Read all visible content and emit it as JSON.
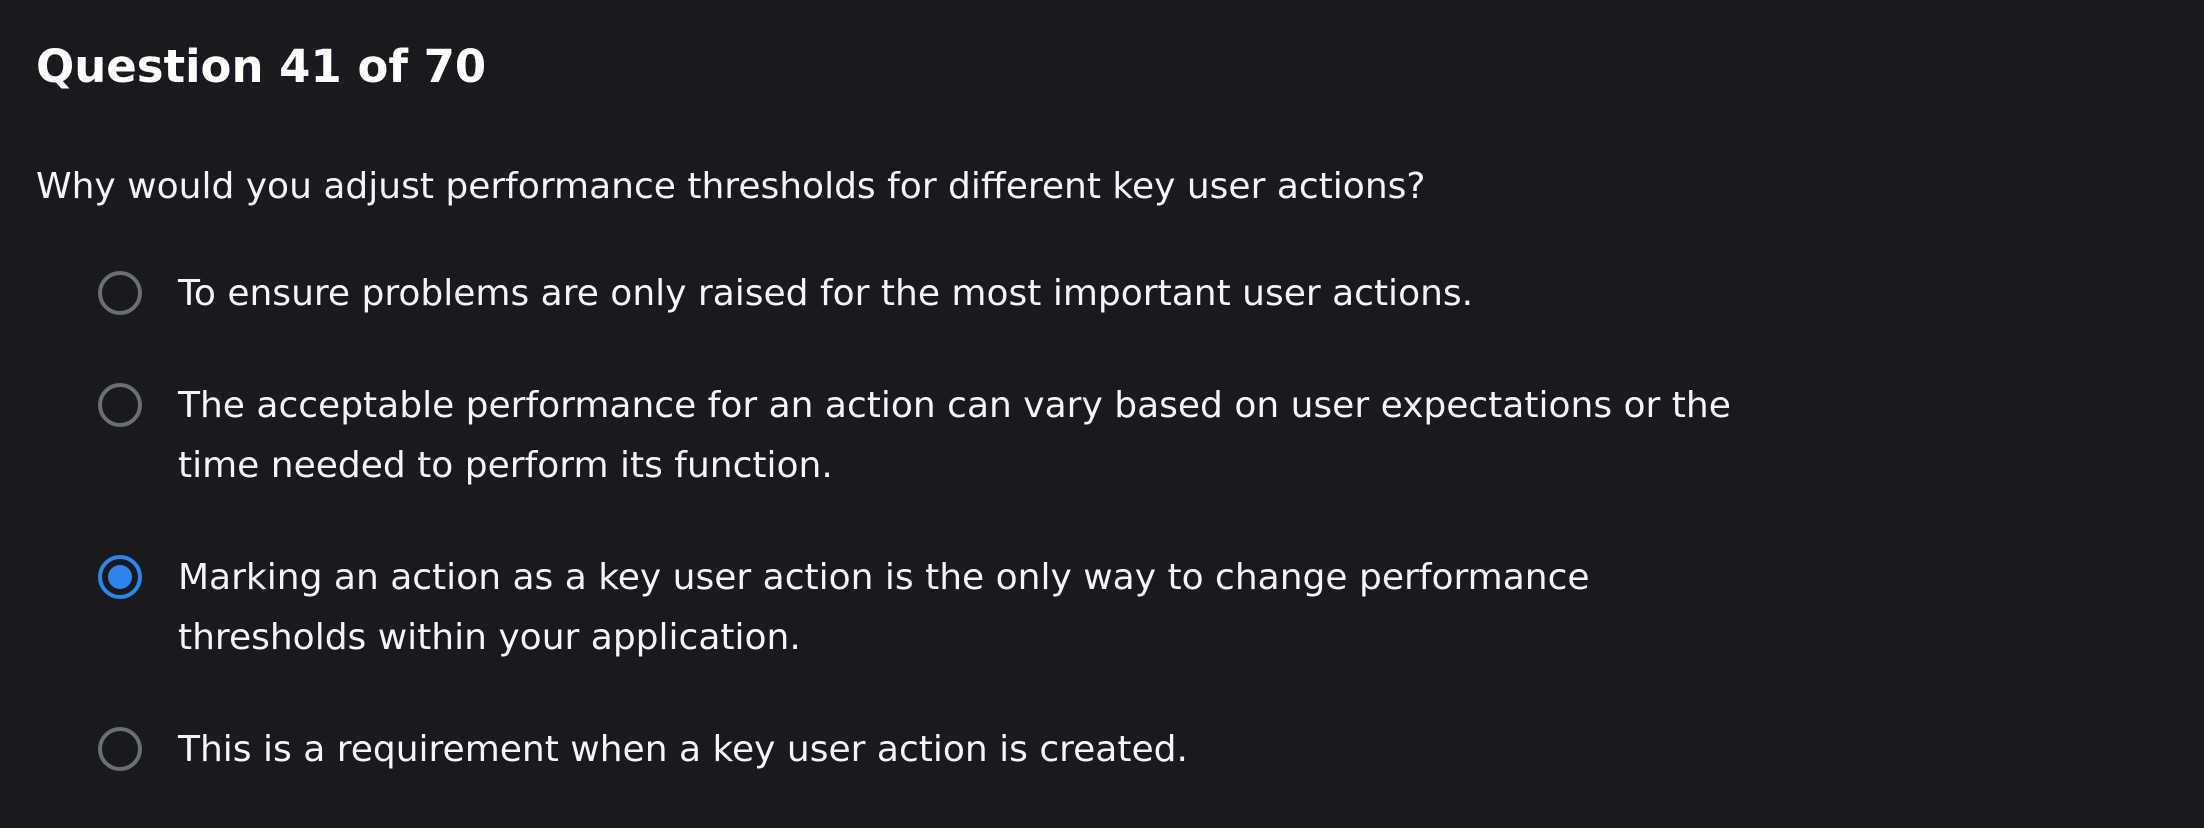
{
  "quiz": {
    "title": "Question 41 of 70",
    "question": "Why would you adjust performance thresholds for different key user actions?",
    "options": [
      {
        "label": "To ensure problems are only raised for the most important user actions.",
        "selected": false
      },
      {
        "label": "The acceptable performance for an action can vary based on user expectations or the time needed to perform its function.",
        "selected": false
      },
      {
        "label": "Marking an action as a key user action is the only way to change performance thresholds within your application.",
        "selected": true
      },
      {
        "label": "This is a requirement when a key user action is created.",
        "selected": false
      }
    ]
  },
  "colors": {
    "background": "#181a1f",
    "text": "#f4f5f7",
    "radio_border": "#6b6e75",
    "accent": "#2f86ea"
  }
}
